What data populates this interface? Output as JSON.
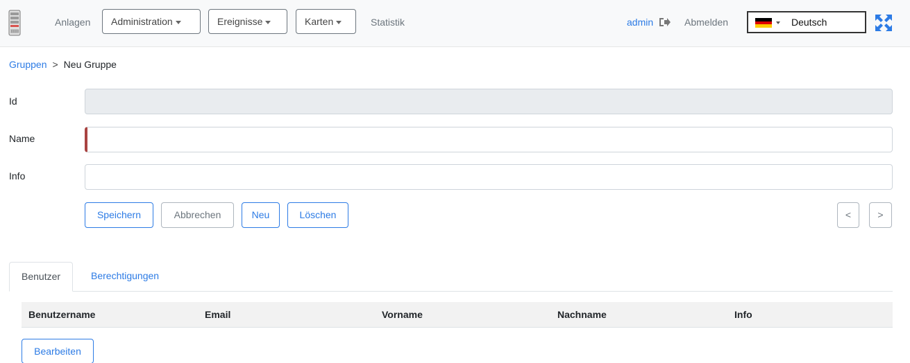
{
  "nav": {
    "logo_icon": "server-icon",
    "anlagen": "Anlagen",
    "administration": "Administration",
    "ereignisse": "Ereignisse",
    "karten": "Karten",
    "statistik": "Statistik",
    "user": "admin",
    "logout": "Abmelden",
    "logout_icon": "sign-out-icon",
    "language": "Deutsch",
    "flag_icon": "german-flag-icon",
    "fullscreen_icon": "expand-icon",
    "accent_color": "#2c7be5"
  },
  "breadcrumb": {
    "parent": "Gruppen",
    "separator": ">",
    "current": "Neu Gruppe"
  },
  "form": {
    "id_label": "Id",
    "id_value": "",
    "name_label": "Name",
    "name_value": "",
    "info_label": "Info",
    "info_value": ""
  },
  "actions": {
    "save": "Speichern",
    "cancel": "Abbrechen",
    "new": "Neu",
    "delete": "Löschen",
    "prev": "<",
    "next": ">"
  },
  "tabs": {
    "users": "Benutzer",
    "permissions": "Berechtigungen",
    "active": "Benutzer"
  },
  "table": {
    "columns": [
      "Benutzername",
      "Email",
      "Vorname",
      "Nachname",
      "Info"
    ],
    "rows": []
  },
  "edit_button": "Bearbeiten"
}
